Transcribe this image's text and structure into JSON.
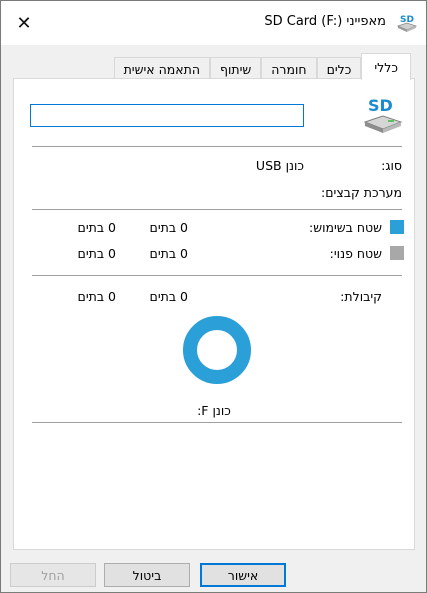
{
  "window": {
    "title": "מאפייני SD Card (F:)",
    "close_glyph": "✕"
  },
  "tabs": [
    {
      "label": "כללי",
      "active": true
    },
    {
      "label": "כלים",
      "active": false
    },
    {
      "label": "חומרה",
      "active": false
    },
    {
      "label": "שיתוף",
      "active": false
    },
    {
      "label": "התאמה אישית",
      "active": false
    }
  ],
  "general": {
    "name_value": "",
    "type_label": "סוג:",
    "type_value": "כונן USB",
    "filesystem_label": "מערכת קבצים:",
    "filesystem_value": "",
    "used": {
      "label": "שטח בשימוש:",
      "bytes": "0 בתים",
      "size": "0 בתים",
      "color": "#2a9fd8"
    },
    "free": {
      "label": "שטח פנוי:",
      "bytes": "0 בתים",
      "size": "0 בתים",
      "color": "#a8a8a8"
    },
    "capacity": {
      "label": "קיבולת:",
      "bytes": "0 בתים",
      "size": "0 בתים"
    },
    "drive_label": "כונן F:",
    "donut_color": "#2a9fd8"
  },
  "buttons": {
    "ok": "אישור",
    "cancel": "ביטול",
    "apply": "החל"
  },
  "icons": {
    "title_icon": "sd-card-icon",
    "drive_icon": "sd-card-icon",
    "close_icon": "close-icon"
  }
}
